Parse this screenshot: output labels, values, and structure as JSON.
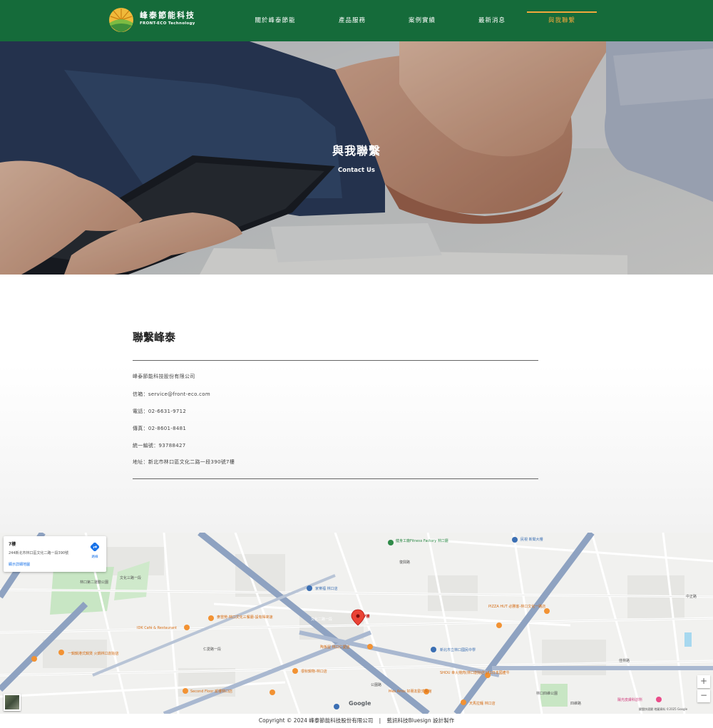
{
  "header": {
    "brand_name": "峰泰節能科技",
    "brand_en": "FRONT-ECO Technology",
    "nav": [
      {
        "label": "關於峰泰節能"
      },
      {
        "label": "產品服務"
      },
      {
        "label": "案例實績"
      },
      {
        "label": "最新消息"
      },
      {
        "label": "與我聯繫"
      }
    ],
    "active_index": 4,
    "active_color": "#f2a83b",
    "bg_color": "#156b3a"
  },
  "hero": {
    "title": "與我聯繫",
    "subtitle": "Contact Us"
  },
  "contact": {
    "title": "聯繫峰泰",
    "company": "峰泰節能科技股份有限公司",
    "email": "信箱：service@front-eco.com",
    "phone": "電話：02-6631-9712",
    "fax": "傳真：02-8601-8481",
    "tax_id": "統一編號：93788427",
    "address": "地址：新北市林口區文化二路一段390號7樓"
  },
  "map": {
    "card_title": "7樓",
    "card_address": "244新北市林口區文化二路一段390號",
    "card_link": "顯示詳細地圖",
    "directions_label": "路線",
    "marker_label": "7樓",
    "zoom_in": "+",
    "zoom_out": "−",
    "google": "Google",
    "attribution": "鍵盤快速鍵  地圖資料 ©2025 Google",
    "labels": {
      "fitness": "健身工廠Fitness Factory 林口廳",
      "minshi": "民視 新聞大樓",
      "park": "林口第二運動公園",
      "jiale": "家樂福 林口店",
      "pizza": "PIZZA HUT 必勝客-林口文化一路店",
      "idk": "IDK Café & Restaurant",
      "mcd": "麥當勞-林口文化三餐廳-設有得來速",
      "hotpot": "一鍋鍋港式鍋煲 火鍋林口創始店",
      "taoyuan": "陶板屋 林口仁愛店",
      "school": "新北市立林口國民中學",
      "shou": "SHOU 幸火燒肉(林口創始店)|F1日本國產牛",
      "hasu": "很秋鍋物-林口店",
      "second": "Second Floor 貳樓林口店",
      "mesamis": "Mes Amis 好朋友歐式餐館",
      "tianma": "天馬拉麵 林口店",
      "sunlight": "陽光皮膚科診所",
      "jinlin_park": "林口四維公園",
      "road_wenhua2": "文化二路一段",
      "road_wenhua3": "文化三路一段",
      "road_renai": "仁愛路一段",
      "road_zhongzheng": "中正路",
      "road_jiahua": "佳林路",
      "road_gongyuan": "公園路",
      "road_sihe": "四維路",
      "road_fuxing": "復興路"
    }
  },
  "footer": {
    "copyright": "Copyright © 2024 峰泰節能科技股份有限公司",
    "separator": "|",
    "design": "藍訊科技Bluesign 設計製作"
  }
}
